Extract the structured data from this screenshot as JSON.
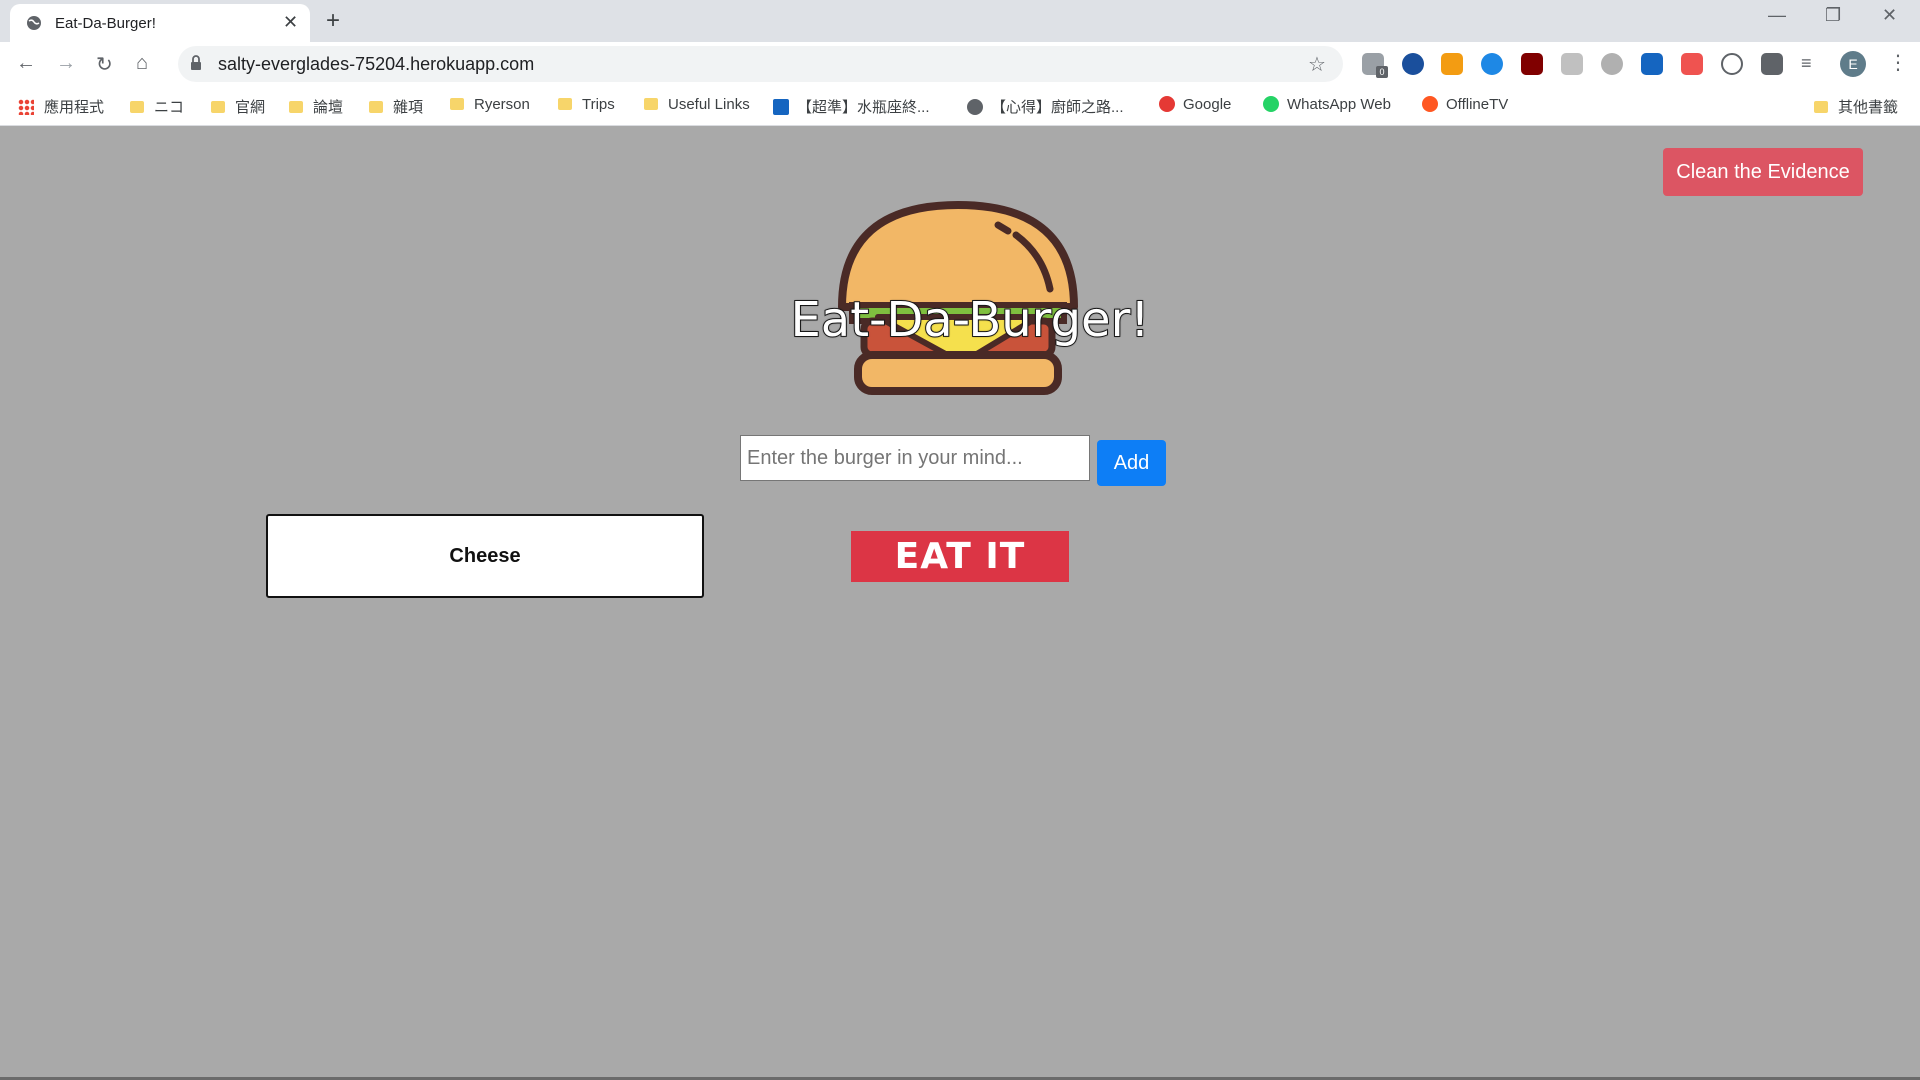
{
  "browser": {
    "tab_title": "Eat-Da-Burger!",
    "url": "salty-everglades-75204.herokuapp.com",
    "profile_initial": "E",
    "bookmarks": [
      {
        "label": "應用程式",
        "kind": "apps"
      },
      {
        "label": "ニコ",
        "kind": "folder"
      },
      {
        "label": "官網",
        "kind": "folder"
      },
      {
        "label": "論壇",
        "kind": "folder"
      },
      {
        "label": "雜項",
        "kind": "folder"
      },
      {
        "label": "Ryerson",
        "kind": "folder"
      },
      {
        "label": "Trips",
        "kind": "folder"
      },
      {
        "label": "Useful Links",
        "kind": "folder"
      },
      {
        "label": "【超準】水瓶座終...",
        "kind": "site"
      },
      {
        "label": "【心得】廚師之路...",
        "kind": "site"
      },
      {
        "label": "Google",
        "kind": "site"
      },
      {
        "label": "WhatsApp Web",
        "kind": "site"
      },
      {
        "label": "OfflineTV",
        "kind": "site"
      },
      {
        "label": "其他書籤",
        "kind": "folder"
      }
    ],
    "extension_badge": "0"
  },
  "page": {
    "clean_button": "Clean the Evidence",
    "title": "Eat-Da-Burger!",
    "input_placeholder": "Enter the burger in your mind...",
    "input_value": "",
    "add_button": "Add",
    "burgers": [
      {
        "name": "Cheese",
        "action": "EAT IT"
      }
    ]
  },
  "colors": {
    "page_bg": "#a9a9a9",
    "danger": "#dc3545",
    "danger_light": "#dc5563",
    "primary": "#0d7ef6"
  }
}
